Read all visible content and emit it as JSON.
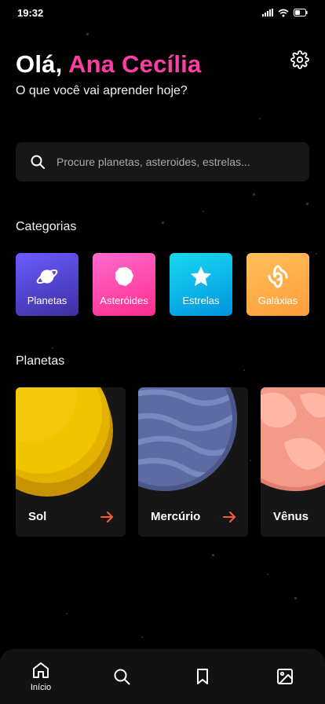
{
  "status_bar": {
    "time": "19:32"
  },
  "header": {
    "greeting_prefix": "Olá,",
    "user_name": "Ana Cecília",
    "subtitle": "O que você vai aprender hoje?"
  },
  "search": {
    "placeholder": "Procure planetas, asteroides, estrelas..."
  },
  "categories": {
    "title": "Categorias",
    "items": [
      {
        "label": "Planetas",
        "icon": "planet-icon"
      },
      {
        "label": "Asteróides",
        "icon": "asteroid-icon"
      },
      {
        "label": "Estrelas",
        "icon": "star-icon"
      },
      {
        "label": "Galáxias",
        "icon": "galaxy-icon"
      }
    ]
  },
  "planets": {
    "title": "Planetas",
    "items": [
      {
        "name": "Sol"
      },
      {
        "name": "Mercúrio"
      },
      {
        "name": "Vênus"
      }
    ]
  },
  "bottom_nav": {
    "items": [
      {
        "label": "Início",
        "icon": "home-icon",
        "active": true
      },
      {
        "label": "",
        "icon": "search-icon"
      },
      {
        "label": "",
        "icon": "bookmark-icon"
      },
      {
        "label": "",
        "icon": "image-icon"
      }
    ]
  },
  "colors": {
    "accent_pink": "#ff3ea5",
    "arrow_orange": "#ff5a3c",
    "card_bg": "#161616"
  }
}
